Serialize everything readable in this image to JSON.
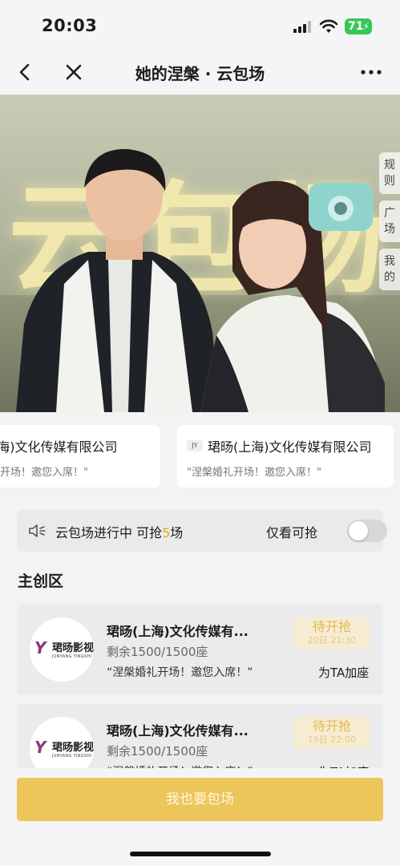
{
  "status_bar": {
    "time": "20:03",
    "battery": "71"
  },
  "nav": {
    "title": "她的涅槃 · 云包场"
  },
  "hero": {
    "big_word": "云包场",
    "side_tabs": [
      "规则",
      "广场",
      "我的"
    ]
  },
  "sponsors": [
    {
      "name": "珺旸(上海)文化传媒有限公司",
      "msg": "\"涅槃婚礼开场！邀您入席！\""
    },
    {
      "name": "珺旸(上海)文化传媒有限公司",
      "msg": "\"涅槃婚礼开场！邀您入席！\""
    }
  ],
  "status_row": {
    "text_before": "云包场进行中 可抢",
    "count": "5",
    "text_after": "场",
    "only_label": "仅看可抢",
    "toggle_on": false
  },
  "section_title": "主创区",
  "items": [
    {
      "logo_cn": "珺旸影视",
      "logo_en": "JUNYANG YINGSHI",
      "name": "珺旸(上海)文化传媒有...",
      "seats": "剩余1500/1500座",
      "quote": "“涅槃婚礼开场！邀您入席！”",
      "badge_status": "待开抢",
      "badge_time": "20日 21:30",
      "seat_button": "为TA加座"
    },
    {
      "logo_cn": "珺旸影视",
      "logo_en": "JUNYANG YINGSHI",
      "name": "珺旸(上海)文化传媒有...",
      "seats": "剩余1500/1500座",
      "quote": "“涅槃婚礼开场！邀您入席！”",
      "badge_status": "待开抢",
      "badge_time": "19日 22:00",
      "seat_button": "为TA加座"
    }
  ],
  "cta": {
    "label": "我也要包场"
  },
  "colors": {
    "accent": "#ecc65a",
    "highlight": "#e2ad18",
    "badge_bg": "#f6ecd4"
  }
}
